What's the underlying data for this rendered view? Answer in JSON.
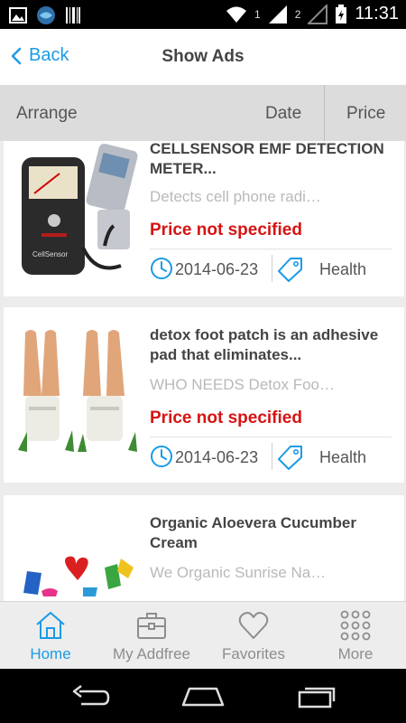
{
  "status_bar": {
    "time": "11:31",
    "sim1": "1",
    "sim2": "2"
  },
  "header": {
    "back_label": "Back",
    "title": "Show Ads"
  },
  "sort_bar": {
    "arrange_label": "Arrange",
    "date_label": "Date",
    "price_label": "Price"
  },
  "ads": [
    {
      "title": "CELLSENSOR EMF DETECTION METER...",
      "description": "Detects cell phone radi…",
      "price": "Price not specified",
      "date": "2014-06-23",
      "category": "Health"
    },
    {
      "title": "detox foot patch is an adhesive pad that eliminates...",
      "description": "WHO NEEDS Detox Foo…",
      "price": "Price not specified",
      "date": "2014-06-23",
      "category": "Health"
    },
    {
      "title": "Organic Aloevera Cucumber Cream",
      "description": "We Organic Sunrise Na…",
      "price": "",
      "date": "",
      "category": ""
    }
  ],
  "tabs": [
    {
      "label": "Home",
      "icon": "home-icon",
      "active": true
    },
    {
      "label": "My Addfree",
      "icon": "briefcase-icon",
      "active": false
    },
    {
      "label": "Favorites",
      "icon": "heart-icon",
      "active": false
    },
    {
      "label": "More",
      "icon": "grid-icon",
      "active": false
    }
  ],
  "colors": {
    "accent": "#1a9be6",
    "price_red": "#d51414",
    "header_bg": "#ffffff",
    "sortbar_bg": "#dcdcdc",
    "tabbar_bg": "#ededed"
  }
}
